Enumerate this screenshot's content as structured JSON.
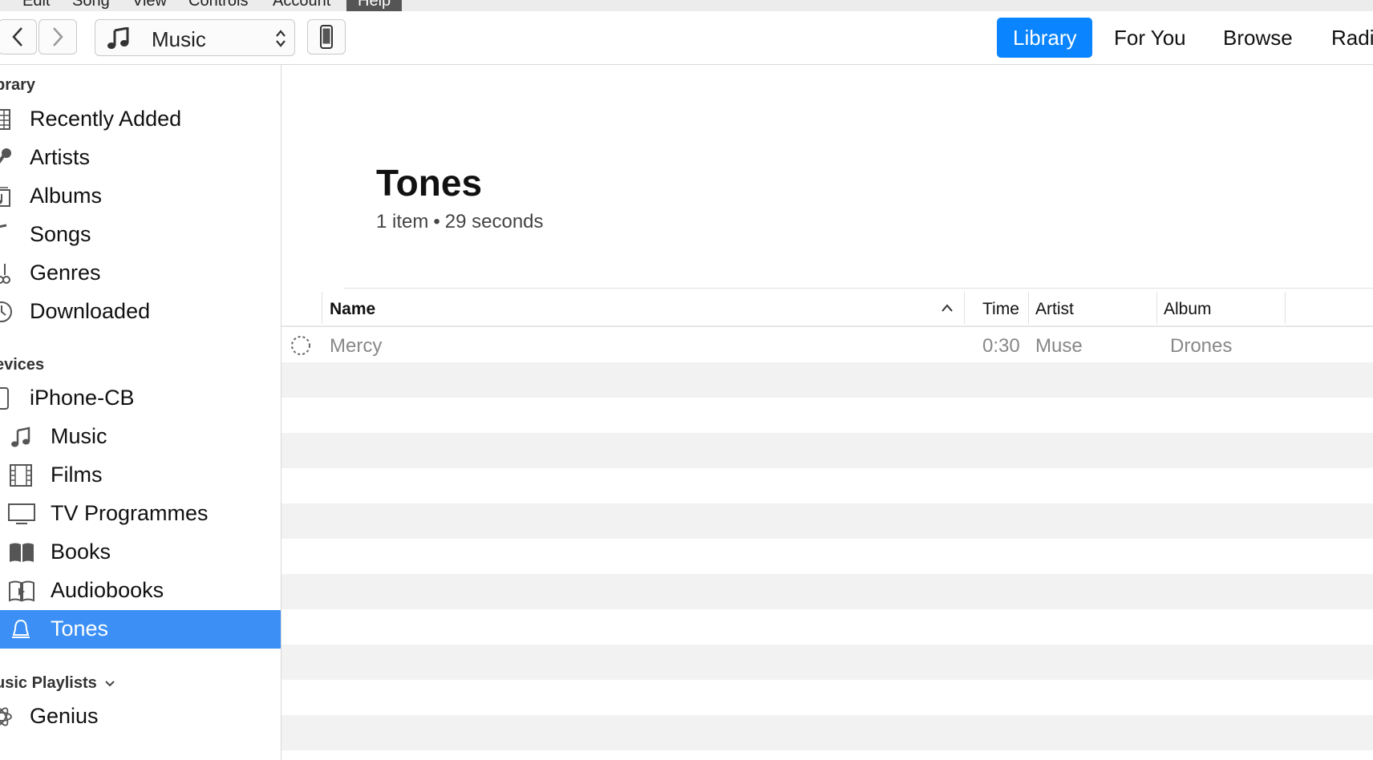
{
  "menubar": {
    "items": [
      {
        "label": "Edit",
        "active": false
      },
      {
        "label": "Song",
        "active": false
      },
      {
        "label": "View",
        "active": false
      },
      {
        "label": "Controls",
        "active": false
      },
      {
        "label": "Account",
        "active": false
      },
      {
        "label": "Help",
        "active": true
      }
    ]
  },
  "toolbar": {
    "media_selector": "Music",
    "tabs": [
      {
        "label": "Library",
        "active": true
      },
      {
        "label": "For You",
        "active": false
      },
      {
        "label": "Browse",
        "active": false
      },
      {
        "label": "Radi",
        "active": false
      }
    ]
  },
  "sidebar": {
    "library_title": "brary",
    "library_items": [
      {
        "label": "Recently Added",
        "icon": "grid-icon"
      },
      {
        "label": "Artists",
        "icon": "microphone-icon"
      },
      {
        "label": "Albums",
        "icon": "album-icon"
      },
      {
        "label": "Songs",
        "icon": "music-note-icon"
      },
      {
        "label": "Genres",
        "icon": "guitar-icon"
      },
      {
        "label": "Downloaded",
        "icon": "download-icon"
      }
    ],
    "devices_title": "evices",
    "device": {
      "label": "iPhone-CB",
      "icon": "phone-icon"
    },
    "device_items": [
      {
        "label": "Music",
        "icon": "music-note-icon"
      },
      {
        "label": "Films",
        "icon": "film-icon"
      },
      {
        "label": "TV Programmes",
        "icon": "tv-icon"
      },
      {
        "label": "Books",
        "icon": "book-icon"
      },
      {
        "label": "Audiobooks",
        "icon": "audiobook-icon"
      },
      {
        "label": "Tones",
        "icon": "bell-icon",
        "selected": true
      }
    ],
    "playlists_title": "usic Playlists",
    "playlist_items": [
      {
        "label": "Genius",
        "icon": "atom-icon"
      }
    ]
  },
  "main": {
    "title": "Tones",
    "subtitle_count": "1 item",
    "subtitle_sep": "•",
    "subtitle_duration": "29 seconds",
    "table": {
      "columns": {
        "name": "Name",
        "time": "Time",
        "artist": "Artist",
        "album": "Album"
      },
      "rows": [
        {
          "name": "Mercy",
          "time": "0:30",
          "artist": "Muse",
          "album": "Drones"
        }
      ]
    }
  },
  "colors": {
    "accent": "#0a84ff",
    "selected_sidebar": "#3b8ff5",
    "stripe": "#f2f2f2"
  }
}
